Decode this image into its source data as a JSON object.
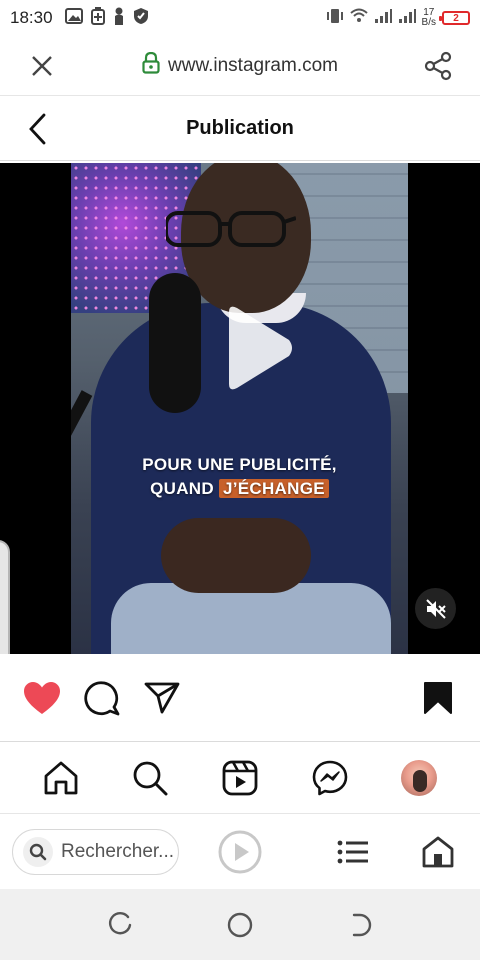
{
  "status_bar": {
    "time": "18:30",
    "speed_value": "17",
    "speed_unit": "B/s",
    "battery_level": "2",
    "icons_left": [
      "gallery-icon",
      "battery-saver-icon",
      "person-icon",
      "shield-icon"
    ],
    "icons_right": [
      "vibrate-icon",
      "wifi-icon",
      "signal-icon",
      "signal-icon"
    ]
  },
  "browser": {
    "url": "www.instagram.com",
    "close_icon": "close-icon",
    "lock_icon": "lock-icon",
    "share_icon": "share-icon",
    "search_placeholder": "Rechercher..."
  },
  "header": {
    "title": "Publication"
  },
  "post": {
    "caption_line1": "POUR UNE PUBLICITÉ,",
    "caption_line2_prefix": "QUAND ",
    "caption_line2_highlight": "J’ÉCHANGE",
    "liked": true,
    "saved": true
  },
  "colors": {
    "like_red": "#ed4956",
    "caption_highlight": "#c7602a",
    "lock_green": "#2e8b3a",
    "battery_red": "#e0292b"
  },
  "ig_nav": [
    "home-icon",
    "search-icon",
    "reels-icon",
    "messenger-icon",
    "avatar"
  ]
}
